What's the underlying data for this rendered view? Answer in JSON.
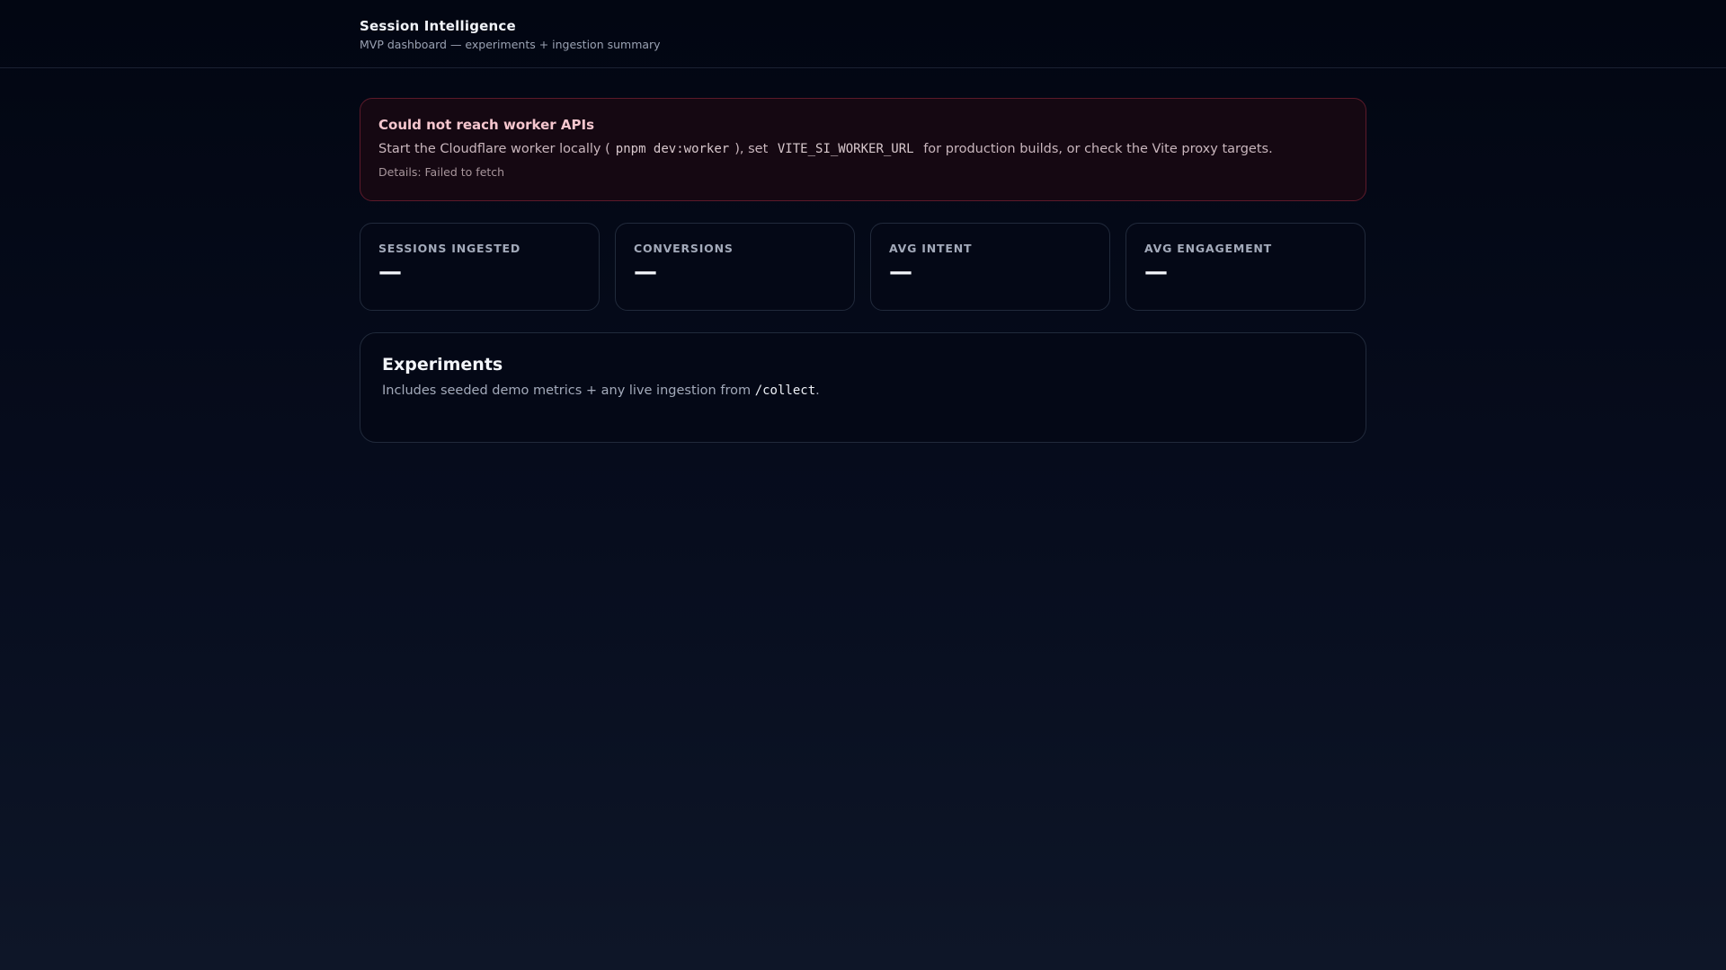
{
  "header": {
    "title": "Session Intelligence",
    "subtitle": "MVP dashboard — experiments + ingestion summary"
  },
  "alert": {
    "title": "Could not reach worker APIs",
    "body_part1": "Start the Cloudflare worker locally (",
    "code1": "pnpm dev:worker",
    "body_part2": "), set",
    "code2": "VITE_SI_WORKER_URL",
    "body_part3": "for production builds, or check the Vite proxy targets.",
    "details": "Details: Failed to fetch"
  },
  "kpis": [
    {
      "label": "SESSIONS INGESTED",
      "value": "—"
    },
    {
      "label": "CONVERSIONS",
      "value": "—"
    },
    {
      "label": "AVG INTENT",
      "value": "—"
    },
    {
      "label": "AVG ENGAGEMENT",
      "value": "—"
    }
  ],
  "experiments": {
    "title": "Experiments",
    "desc_prefix": "Includes seeded demo metrics + any live ingestion from ",
    "desc_code": "/collect",
    "desc_suffix": "."
  }
}
